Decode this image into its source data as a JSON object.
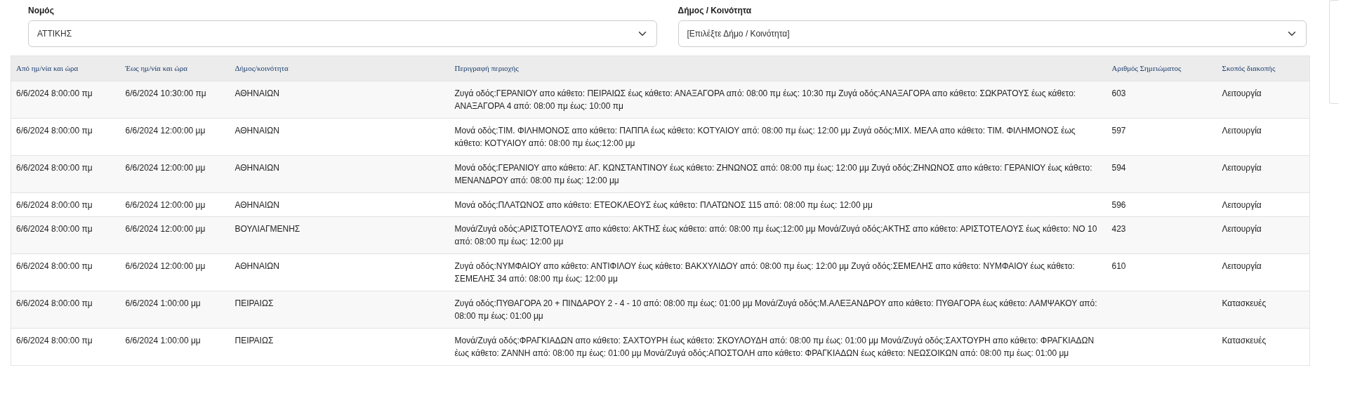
{
  "filters": [
    {
      "label": "Νομός",
      "value": "ΑΤΤΙΚΗΣ"
    },
    {
      "label": "Δήμος / Κοινότητα",
      "value": "[Επιλέξτε Δήμο / Κοινότητα]"
    }
  ],
  "table": {
    "columns": [
      "Από ημ/νία και ώρα",
      "Έως ημ/νία και ώρα",
      "Δήμος/κοινότητα",
      "Περιγραφή περιοχής",
      "Αριθμός Σημειώματος",
      "Σκοπός διακοπής"
    ],
    "rows": [
      [
        "6/6/2024 8:00:00 πμ",
        "6/6/2024 10:30:00 πμ",
        "ΑΘΗΝΑΙΩΝ",
        "Ζυγά οδός:ΓΕΡΑΝΙΟΥ απο κάθετο: ΠΕΙΡΑΙΩΣ έως κάθετο: ΑΝΑΞΑΓΟΡΑ από: 08:00 πμ έως: 10:30 πμ Ζυγά οδός:ΑΝΑΞΑΓΟΡΑ απο κάθετο: ΣΩΚΡΑΤΟΥΣ έως κάθετο: ΑΝΑΞΑΓΟΡΑ 4 από: 08:00 πμ έως: 10:00 πμ",
        "603",
        "Λειτουργία"
      ],
      [
        "6/6/2024 8:00:00 πμ",
        "6/6/2024 12:00:00 μμ",
        "ΑΘΗΝΑΙΩΝ",
        "Μονά οδός:ΤΙΜ. ΦΙΛΗΜΟΝΟΣ απο κάθετο: ΠΑΠΠΑ έως κάθετο: ΚΟΤΥΑΙΟΥ από: 08:00 πμ έως: 12:00 μμ Ζυγά οδός:ΜΙΧ. ΜΕΛΑ απο κάθετο: ΤΙΜ. ΦΙΛΗΜΟΝΟΣ έως κάθετο: ΚΟΤΥΑΙΟΥ από: 08:00 πμ έως:12:00 μμ",
        "597",
        "Λειτουργία"
      ],
      [
        "6/6/2024 8:00:00 πμ",
        "6/6/2024 12:00:00 μμ",
        "ΑΘΗΝΑΙΩΝ",
        "Μονά οδός:ΓΕΡΑΝΙΟΥ απο κάθετο: ΑΓ. ΚΩΝΣΤΑΝΤΙΝΟΥ έως κάθετο: ΖΗΝΩΝΟΣ από: 08:00 πμ έως: 12:00 μμ Ζυγά οδός:ΖΗΝΩΝΟΣ απο κάθετο: ΓΕΡΑΝΙΟΥ έως κάθετο: ΜΕΝΑΝΔΡΟΥ από: 08:00 πμ έως: 12:00 μμ",
        "594",
        "Λειτουργία"
      ],
      [
        "6/6/2024 8:00:00 πμ",
        "6/6/2024 12:00:00 μμ",
        "ΑΘΗΝΑΙΩΝ",
        "Μονά οδός:ΠΛΑΤΩΝΟΣ απο κάθετο: ΕΤΕΟΚΛΕΟΥΣ έως κάθετο: ΠΛΑΤΩΝΟΣ 115 από: 08:00 πμ έως: 12:00 μμ",
        "596",
        "Λειτουργία"
      ],
      [
        "6/6/2024 8:00:00 πμ",
        "6/6/2024 12:00:00 μμ",
        "ΒΟΥΛΙΑΓΜΕΝΗΣ",
        "Μονά/Ζυγά οδός:ΑΡΙΣΤΟΤΕΛΟΥΣ απο κάθετο: ΑΚΤΗΣ έως κάθετο: από: 08:00 πμ έως:12:00 μμ Μονά/Ζυγά οδός:ΑΚΤΗΣ απο κάθετο: ΑΡΙΣΤΟΤΕΛΟΥΣ έως κάθετο: ΝΟ 10 από: 08:00 πμ έως: 12:00 μμ",
        "423",
        "Λειτουργία"
      ],
      [
        "6/6/2024 8:00:00 πμ",
        "6/6/2024 12:00:00 μμ",
        "ΑΘΗΝΑΙΩΝ",
        "Ζυγά οδός:ΝΥΜΦΑΙΟΥ απο κάθετο: ΑΝΤΙΦΙΛΟΥ έως κάθετο: ΒΑΚΧΥΛΙΔΟΥ από: 08:00 πμ έως: 12:00 μμ Ζυγά οδός:ΣΕΜΕΛΗΣ απο κάθετο: ΝΥΜΦΑΙΟΥ έως κάθετο: ΣΕΜΕΛΗΣ 34 από: 08:00 πμ έως: 12:00 μμ",
        "610",
        "Λειτουργία"
      ],
      [
        "6/6/2024 8:00:00 πμ",
        "6/6/2024 1:00:00 μμ",
        "ΠΕΙΡΑΙΩΣ",
        "Ζυγά οδός:ΠΥΘΑΓΟΡΑ 20 + ΠΙΝΔΑΡΟΥ 2 - 4 - 10 από: 08:00 πμ έως: 01:00 μμ Μονά/Ζυγά οδός:Μ.ΑΛΕΞΑΝΔΡΟΥ απο κάθετο: ΠΥΘΑΓΟΡΑ έως κάθετο: ΛΑΜΨΑΚΟΥ από: 08:00 πμ έως: 01:00 μμ",
        null,
        "Κατασκευές"
      ],
      [
        "6/6/2024 8:00:00 πμ",
        "6/6/2024 1:00:00 μμ",
        "ΠΕΙΡΑΙΩΣ",
        "Μονά/Ζυγά οδός:ΦΡΑΓΚΙΑΔΩΝ απο κάθετο: ΣΑΧΤΟΥΡΗ έως κάθετο: ΣΚΟΥΛΟΥΔΗ από: 08:00 πμ έως: 01:00 μμ Μονά/Ζυγά οδός:ΣΑΧΤΟΥΡΗ απο κάθετο: ΦΡΑΓΚΙΑΔΩΝ έως κάθετο: ΖΑΝΝΗ από: 08:00 πμ έως: 01:00 μμ Μονά/Ζυγά οδός:ΑΠΟΣΤΟΛΗ απο κάθετο: ΦΡΑΓΚΙΑΔΩΝ έως κάθετο: ΝΕΩΣΟΙΚΩΝ από: 08:00 πμ έως: 01:00 μμ",
        null,
        "Κατασκευές"
      ]
    ]
  }
}
